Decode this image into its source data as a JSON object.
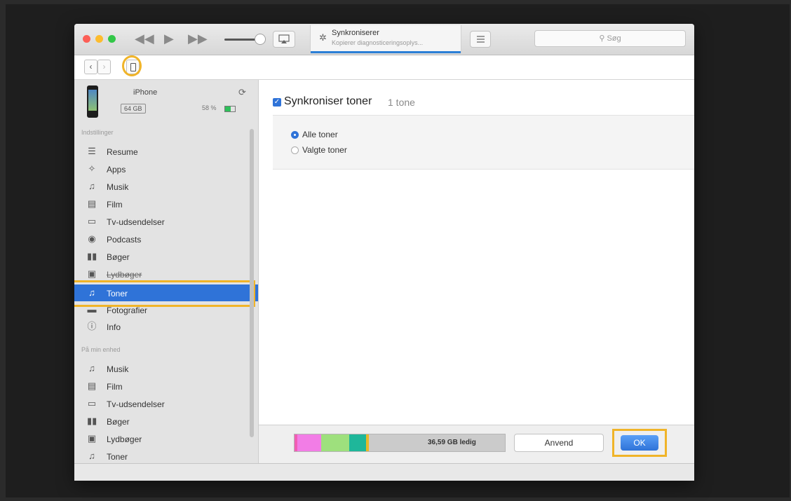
{
  "window": {
    "lcd": {
      "title": "Synkroniserer",
      "subtitle": "Kopierer diagnosticeringsoplys..."
    },
    "search": {
      "placeholder": "Søg"
    }
  },
  "device": {
    "name": "iPhone",
    "capacity": "64 GB",
    "battery": "58 %"
  },
  "sidebar": {
    "settings_heading": "Indstillinger",
    "settings": [
      {
        "label": "Resume",
        "icon": "summary-icon"
      },
      {
        "label": "Apps",
        "icon": "apps-icon"
      },
      {
        "label": "Musik",
        "icon": "music-icon"
      },
      {
        "label": "Film",
        "icon": "film-icon"
      },
      {
        "label": "Tv-udsendelser",
        "icon": "tv-icon"
      },
      {
        "label": "Podcasts",
        "icon": "podcast-icon"
      },
      {
        "label": "Bøger",
        "icon": "books-icon"
      },
      {
        "label": "Lydbøger",
        "icon": "audiobook-icon"
      },
      {
        "label": "Toner",
        "icon": "bell-icon",
        "selected": true
      },
      {
        "label": "Fotografier",
        "icon": "photos-icon"
      },
      {
        "label": "Info",
        "icon": "info-icon"
      }
    ],
    "device_heading": "På min enhed",
    "on_device": [
      {
        "label": "Musik",
        "icon": "music-icon"
      },
      {
        "label": "Film",
        "icon": "film-icon"
      },
      {
        "label": "Tv-udsendelser",
        "icon": "tv-icon"
      },
      {
        "label": "Bøger",
        "icon": "books-icon"
      },
      {
        "label": "Lydbøger",
        "icon": "audiobook-icon"
      },
      {
        "label": "Toner",
        "icon": "bell-icon"
      }
    ]
  },
  "main": {
    "sync_label": "Synkroniser toner",
    "sync_count": "1 tone",
    "sync_checked": true,
    "options": [
      {
        "label": "Alle toner",
        "selected": true
      },
      {
        "label": "Valgte toner",
        "selected": false
      }
    ]
  },
  "footer": {
    "free_space": "36,59 GB ledig",
    "apply_label": "Anvend",
    "ok_label": "OK",
    "storage_colors": [
      "#f15eb4",
      "#f27de6",
      "#9ee07d",
      "#7ad68a",
      "#1fb79a",
      "#e8b82a"
    ]
  },
  "colors": {
    "accent": "#2f73d8",
    "highlight": "#f0b429"
  }
}
